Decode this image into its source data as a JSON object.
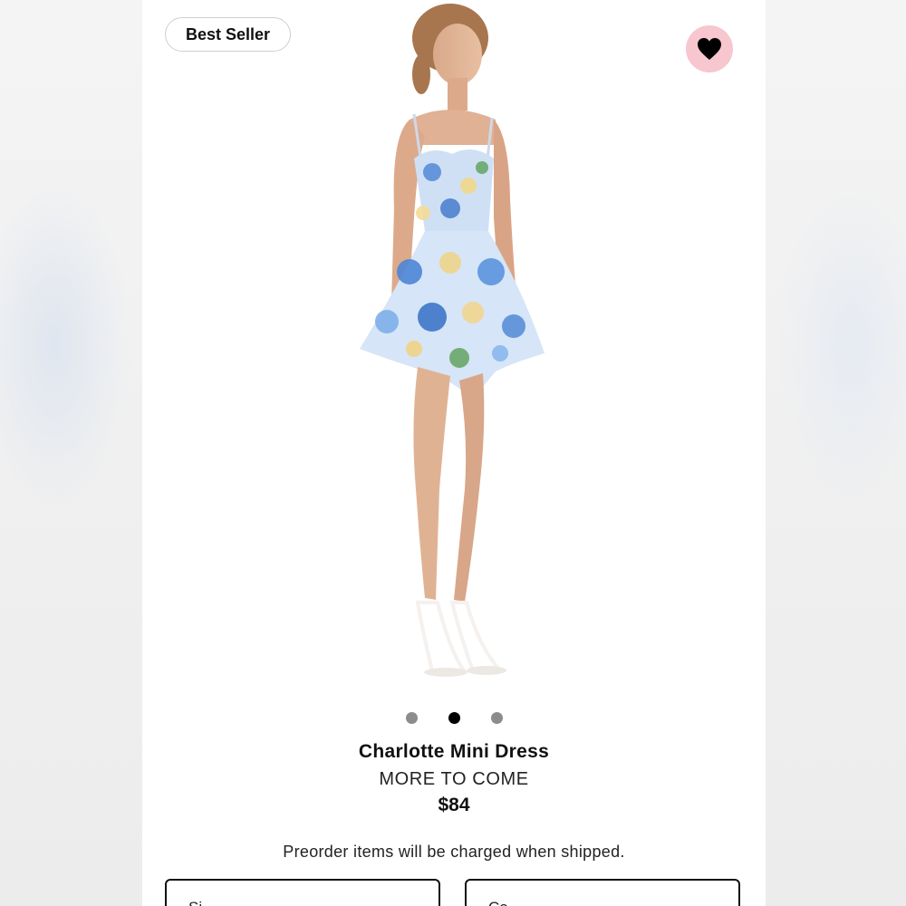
{
  "badge": {
    "label": "Best Seller"
  },
  "favorite": {
    "icon": "heart-icon",
    "bg_color": "#f7c6cf"
  },
  "carousel": {
    "count": 3,
    "active_index": 1
  },
  "product": {
    "name": "Charlotte Mini Dress",
    "status": "MORE TO COME",
    "price": "$84"
  },
  "notice": "Preorder items will be charged when shipped.",
  "selectors": {
    "size_label": "Si",
    "color_label": "Co"
  }
}
